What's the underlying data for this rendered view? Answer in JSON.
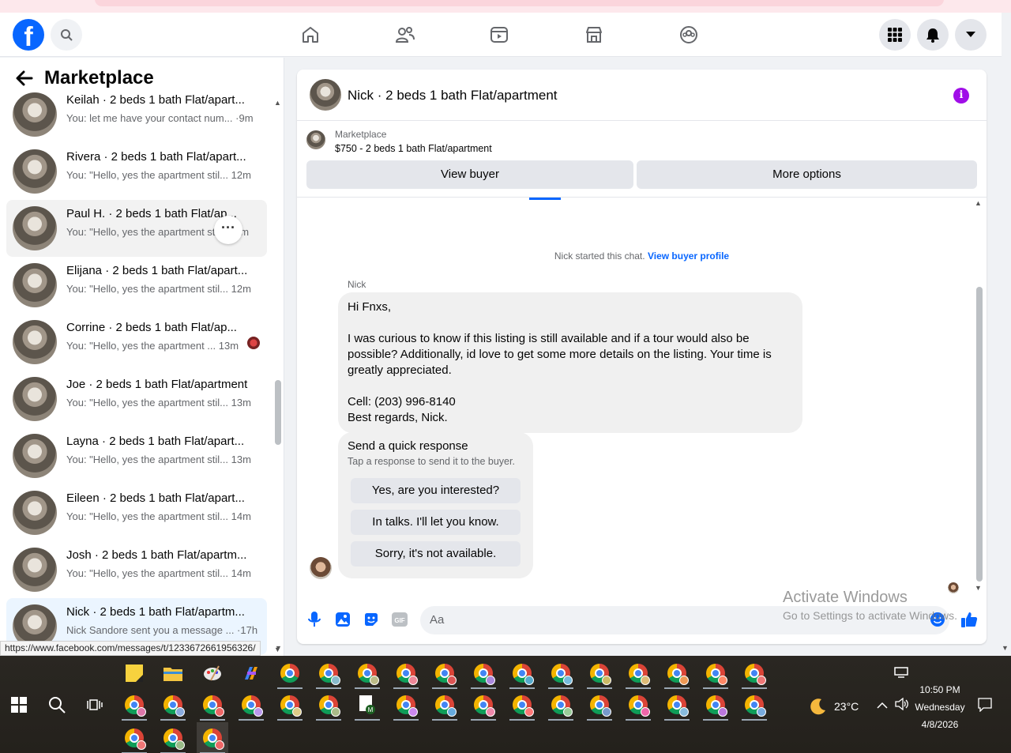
{
  "page": {
    "title": "Marketplace"
  },
  "conversations": [
    {
      "name": "Keilah · 2 beds 1 bath Flat/apart...",
      "preview": "You: let me have your contact num... ·9m"
    },
    {
      "name": "Rivera · 2 beds 1 bath Flat/apart...",
      "preview": "You: \"Hello, yes the apartment stil... 12m"
    },
    {
      "name": "Paul H. · 2 beds 1 bath Flat/ap...",
      "preview": "You: \"Hello, yes the apartment sti... 12m"
    },
    {
      "name": "Elijana · 2 beds 1 bath Flat/apart...",
      "preview": "You: \"Hello, yes the apartment stil... 12m"
    },
    {
      "name": "Corrine · 2 beds 1 bath Flat/ap...",
      "preview": "You: \"Hello, yes the apartment ... 13m"
    },
    {
      "name": "Joe · 2 beds 1 bath Flat/apartment",
      "preview": "You: \"Hello, yes the apartment stil... 13m"
    },
    {
      "name": "Layna · 2 beds 1 bath Flat/apart...",
      "preview": "You: \"Hello, yes the apartment stil... 13m"
    },
    {
      "name": "Eileen · 2 beds 1 bath Flat/apart...",
      "preview": "You: \"Hello, yes the apartment stil... 14m"
    },
    {
      "name": "Josh · 2 beds 1 bath Flat/apartm...",
      "preview": "You: \"Hello, yes the apartment stil... 14m"
    },
    {
      "name": "Nick · 2 beds 1 bath Flat/apartm...",
      "preview": "Nick Sandore sent you a message ... ·17h"
    }
  ],
  "chat": {
    "title": "Nick · 2 beds 1 bath Flat/apartment",
    "listing_source": "Marketplace",
    "listing_desc": "$750 - 2 beds 1 bath Flat/apartment",
    "view_buyer": "View buyer",
    "more_options": "More options",
    "system_msg": "Nick started this chat.",
    "system_link": "View buyer profile",
    "sender": "Nick",
    "message": "Hi Fnxs,\n\nI was curious to know if this listing is still available and if a tour would also be possible? Additionally, id love to get some more details on the listing. Your time is greatly appreciated.\n\nCell: (203) 996-8140\nBest regards, Nick.",
    "quick_title": "Send a quick response",
    "quick_sub": "Tap a response to send it to the buyer.",
    "quick_responses": [
      "Yes, are you interested?",
      "In talks. I'll let you know.",
      "Sorry, it's not available."
    ],
    "input_placeholder": "Aa"
  },
  "watermark": {
    "line1": "Activate Windows",
    "line2": "Go to Settings to activate Windows."
  },
  "status_url": "https://www.facebook.com/messages/t/1233672661956326/",
  "taskbar": {
    "weather_temp": "23°C",
    "time": "10:50 PM",
    "day": "Wednesday",
    "date": "4/8/2026"
  },
  "colors": {
    "accent": "#0866ff",
    "info": "#a00ee8"
  },
  "icons": [
    "facebook-logo",
    "search-icon",
    "home-icon",
    "friends-icon",
    "video-icon",
    "marketplace-icon",
    "groups-icon",
    "menu-grid-icon",
    "bell-icon",
    "chevron-down-icon",
    "back-arrow-icon",
    "info-icon",
    "microphone-icon",
    "image-icon",
    "sticker-icon",
    "gif-icon",
    "emoji-icon",
    "like-icon"
  ]
}
